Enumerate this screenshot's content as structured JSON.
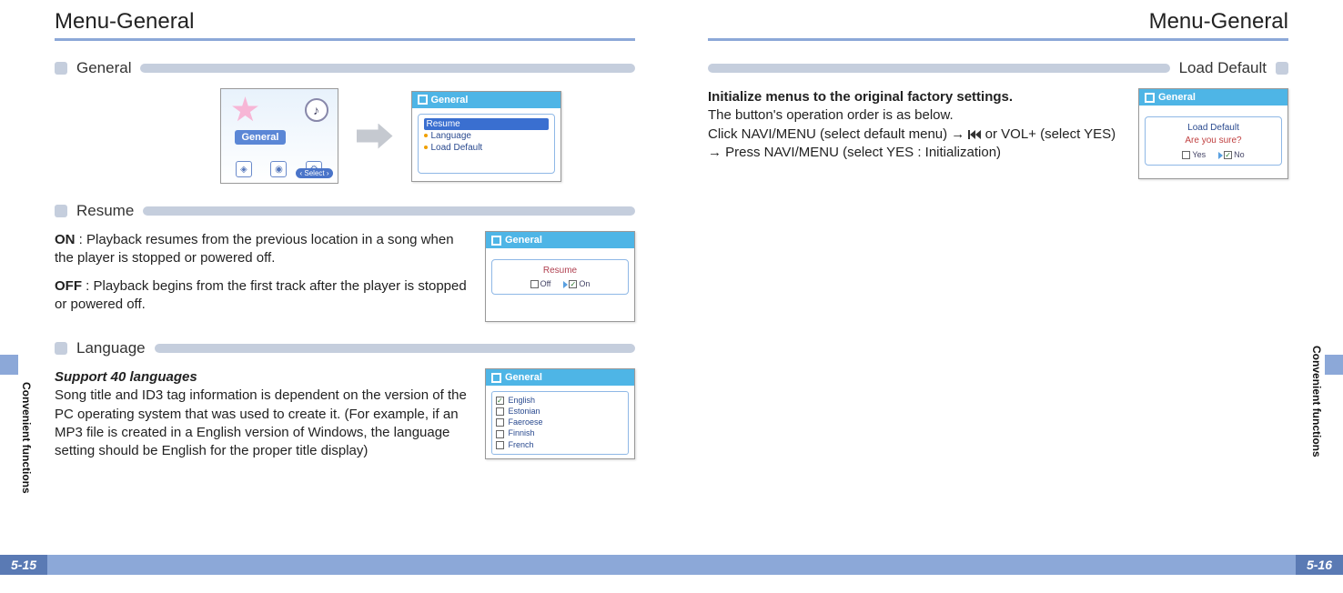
{
  "left": {
    "title": "Menu-General",
    "sideTab": "Convenient functions",
    "pageNum": "5-15",
    "sections": {
      "general": {
        "label": "General",
        "iconLabel": "General",
        "selectPill": "Select",
        "menuHeader": "General",
        "items": [
          "Resume",
          "Language",
          "Load Default"
        ]
      },
      "resume": {
        "label": "Resume",
        "onLabel": "ON",
        "onText": " : Playback resumes from the previous location in a song when the player is stopped or powered off.",
        "offLabel": "OFF",
        "offText": " : Playback begins from the first track after the player is stopped or powered off.",
        "screenHeader": "General",
        "popupTitle": "Resume",
        "optOff": "Off",
        "optOn": "On"
      },
      "language": {
        "label": "Language",
        "subhead": "Support 40 languages",
        "body": "Song title and ID3 tag information is dependent on the version of the PC operating system that was used to create it.  (For example, if an MP3 file is created in a English version of Windows, the language setting should be English for the proper title display)",
        "screenHeader": "General",
        "langs": [
          "English",
          "Estonian",
          "Faeroese",
          "Finnish",
          "French"
        ]
      }
    }
  },
  "right": {
    "title": "Menu-General",
    "sideTab": "Convenient functions",
    "pageNum": "5-16",
    "sections": {
      "loadDefault": {
        "label": "Load Default",
        "line1": "Initialize menus to the original factory settings.",
        "line2": "The button's operation order is as below.",
        "line3a": "Click NAVI/MENU (select default menu) → ",
        "line3b": " or VOL+ (select YES)  → Press NAVI/MENU (select YES : Initialization)",
        "screenHeader": "General",
        "item1": "Load Default",
        "confirm": "Are you sure?",
        "yes": "Yes",
        "no": "No"
      }
    }
  }
}
